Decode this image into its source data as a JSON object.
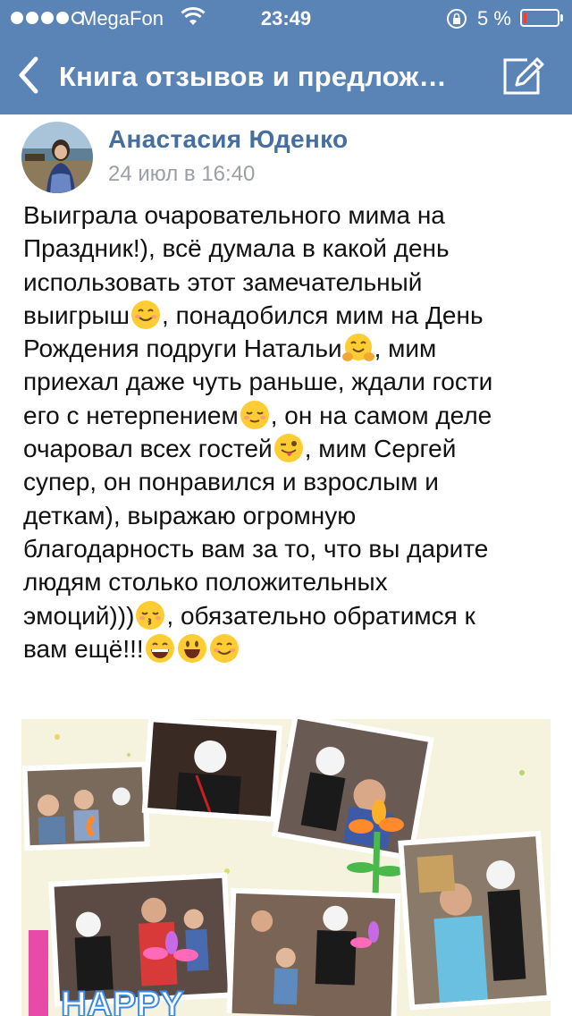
{
  "status_bar": {
    "carrier": "MegaFon",
    "time": "23:49",
    "battery_percent": "5 %",
    "battery_level": 0.05,
    "signal_dots_filled": 4,
    "signal_dots_total": 5
  },
  "nav": {
    "title": "Книга отзывов и предлож…",
    "back_icon": "chevron-left-icon",
    "compose_icon": "compose-icon"
  },
  "post": {
    "author": "Анастасия Юденко",
    "date": "24 июл в 16:40",
    "lines": [
      "Выиграла очаровательного мима на",
      "Праздник!), всё думала в какой день",
      "использовать этот замечательный",
      "выигрыш",
      ", понадобился мим на День",
      "Рождения подруги Натальи",
      ", мим",
      "приехал даже чуть раньше, ждали гости",
      "его с нетерпением",
      ", он на самом деле",
      "очаровал всех гостей",
      ", мим Сергей",
      "супер, он понравился и взрослым и",
      "деткам), выражаю огромную",
      "благодарность вам за то, что вы дарите",
      "людям столько положительных",
      "эмоций)))",
      ", обязательно обратимся к",
      "вам ещё!!!"
    ],
    "photo_text": "HAPPY"
  },
  "colors": {
    "nav_background": "#5b84b6",
    "author_link": "#456f9f",
    "date_gray": "#9aa0a6",
    "battery_low": "#ff3b30"
  }
}
